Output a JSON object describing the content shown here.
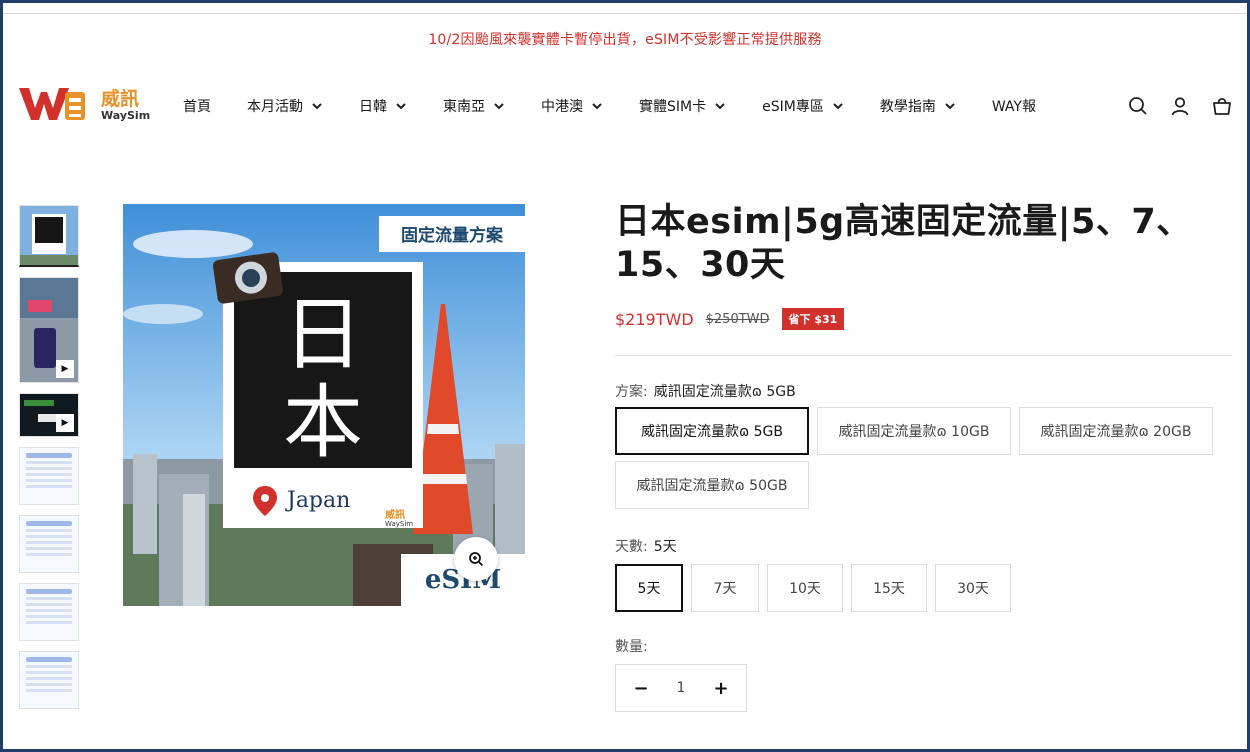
{
  "announcement": "10/2因颱風來襲實體卡暫停出貨，eSIM不受影響正常提供服務",
  "logo": {
    "cn": "威訊",
    "en": "WaySim"
  },
  "nav": [
    {
      "label": "首頁",
      "dropdown": false
    },
    {
      "label": "本月活動",
      "dropdown": true
    },
    {
      "label": "日韓",
      "dropdown": true
    },
    {
      "label": "東南亞",
      "dropdown": true
    },
    {
      "label": "中港澳",
      "dropdown": true
    },
    {
      "label": "實體SIM卡",
      "dropdown": true
    },
    {
      "label": "eSIM專區",
      "dropdown": true
    },
    {
      "label": "教學指南",
      "dropdown": true
    },
    {
      "label": "WAY報",
      "dropdown": false
    }
  ],
  "header_icons": [
    "search-icon",
    "account-icon",
    "cart-icon"
  ],
  "gallery": {
    "thumbnails": 7,
    "image_text": {
      "banner": "固定流量方案",
      "big_char_1": "日",
      "big_char_2": "本",
      "country": "Japan",
      "brand_cn": "威訊",
      "brand_en": "WaySim",
      "esim": "eSIM"
    }
  },
  "product": {
    "title": "日本esim|5g高速固定流量|5、7、15、30天",
    "price_sale": "$219TWD",
    "price_original": "$250TWD",
    "save_badge": "省下 $31",
    "plan_label": "方案:",
    "plan_selected": "威訊固定流量款ɷ 5GB",
    "plans": [
      "威訊固定流量款ɷ 5GB",
      "威訊固定流量款ɷ 10GB",
      "威訊固定流量款ɷ 20GB",
      "威訊固定流量款ɷ 50GB"
    ],
    "days_label": "天數:",
    "days_selected": "5天",
    "days": [
      "5天",
      "7天",
      "10天",
      "15天",
      "30天"
    ],
    "qty_label": "數量:",
    "qty_value": "1",
    "qty_minus": "−",
    "qty_plus": "+"
  },
  "colors": {
    "accent_red": "#d0312d",
    "frame": "#1f3f6a",
    "logo_orange": "#e8932a"
  }
}
